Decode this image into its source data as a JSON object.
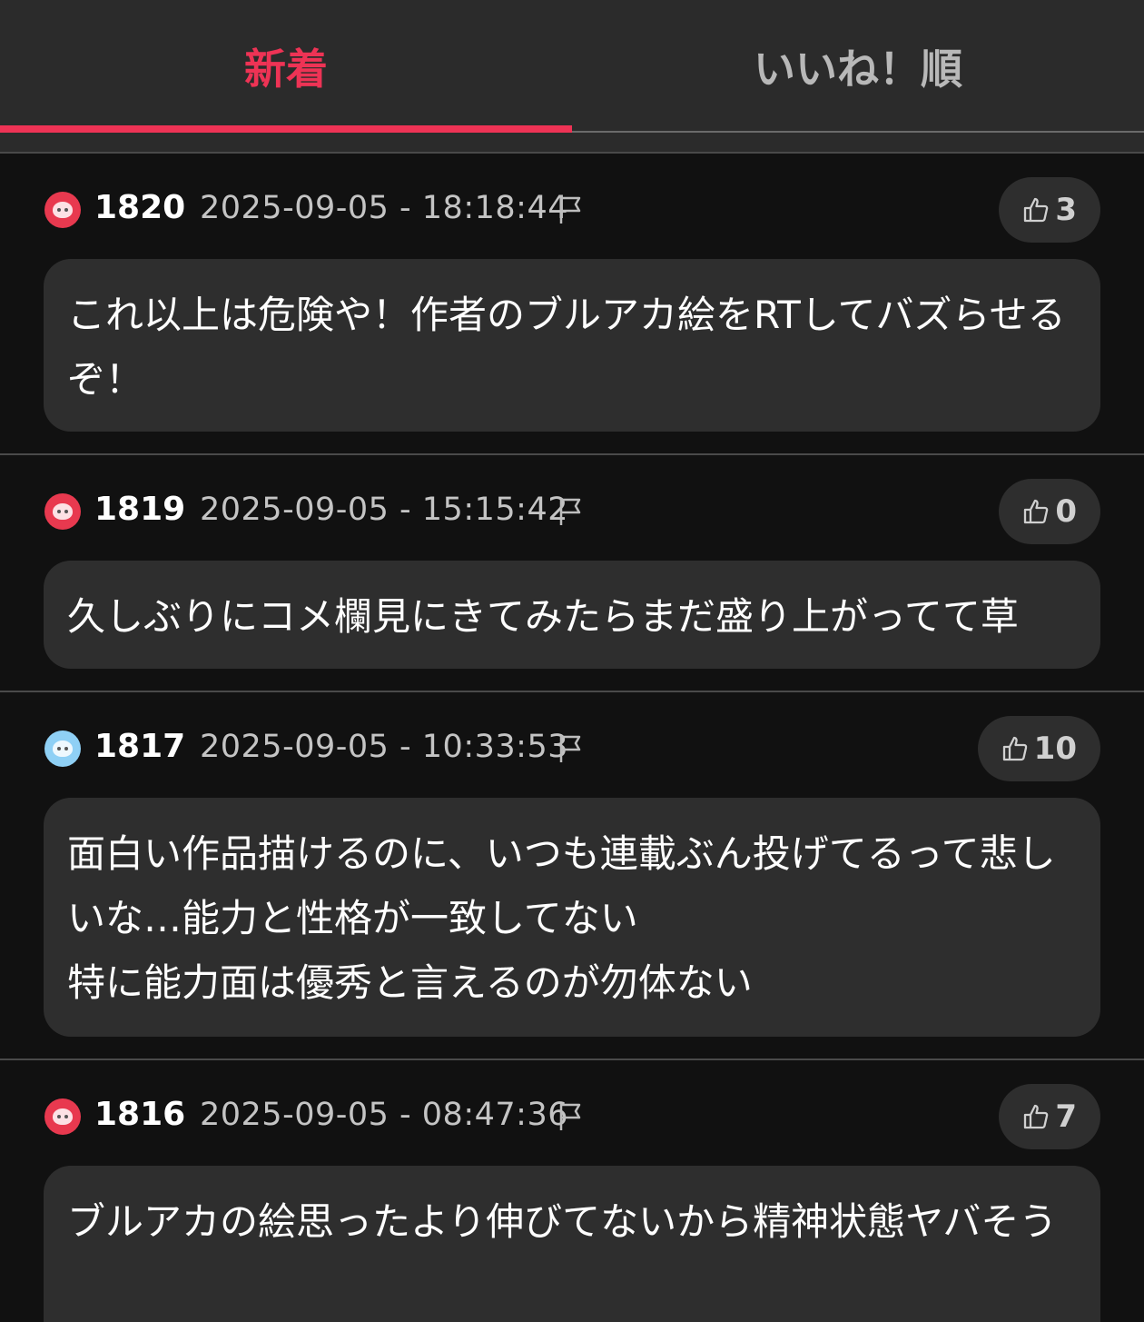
{
  "tabs": {
    "newest": "新着",
    "by_likes": "いいね！順"
  },
  "colors": {
    "accent": "#ee3355",
    "avatar_red": "#e8394f",
    "avatar_blue": "#8fd0f5"
  },
  "comments": [
    {
      "number": "1820",
      "datetime": "2025-09-05 - 18:18:44",
      "likes": "3",
      "avatar": "red",
      "text": "これ以上は危険や！作者のブルアカ絵をRTしてバズらせるぞ！"
    },
    {
      "number": "1819",
      "datetime": "2025-09-05 - 15:15:42",
      "likes": "0",
      "avatar": "red",
      "text": "久しぶりにコメ欄見にきてみたらまだ盛り上がってて草"
    },
    {
      "number": "1817",
      "datetime": "2025-09-05 - 10:33:53",
      "likes": "10",
      "avatar": "blue",
      "text": "面白い作品描けるのに、いつも連載ぶん投げてるって悲しいな…能力と性格が一致してない\n特に能力面は優秀と言えるのが勿体ない"
    },
    {
      "number": "1816",
      "datetime": "2025-09-05 - 08:47:36",
      "likes": "7",
      "avatar": "red",
      "text": "ブルアカの絵思ったより伸びてないから精神状態ヤバそう"
    }
  ]
}
